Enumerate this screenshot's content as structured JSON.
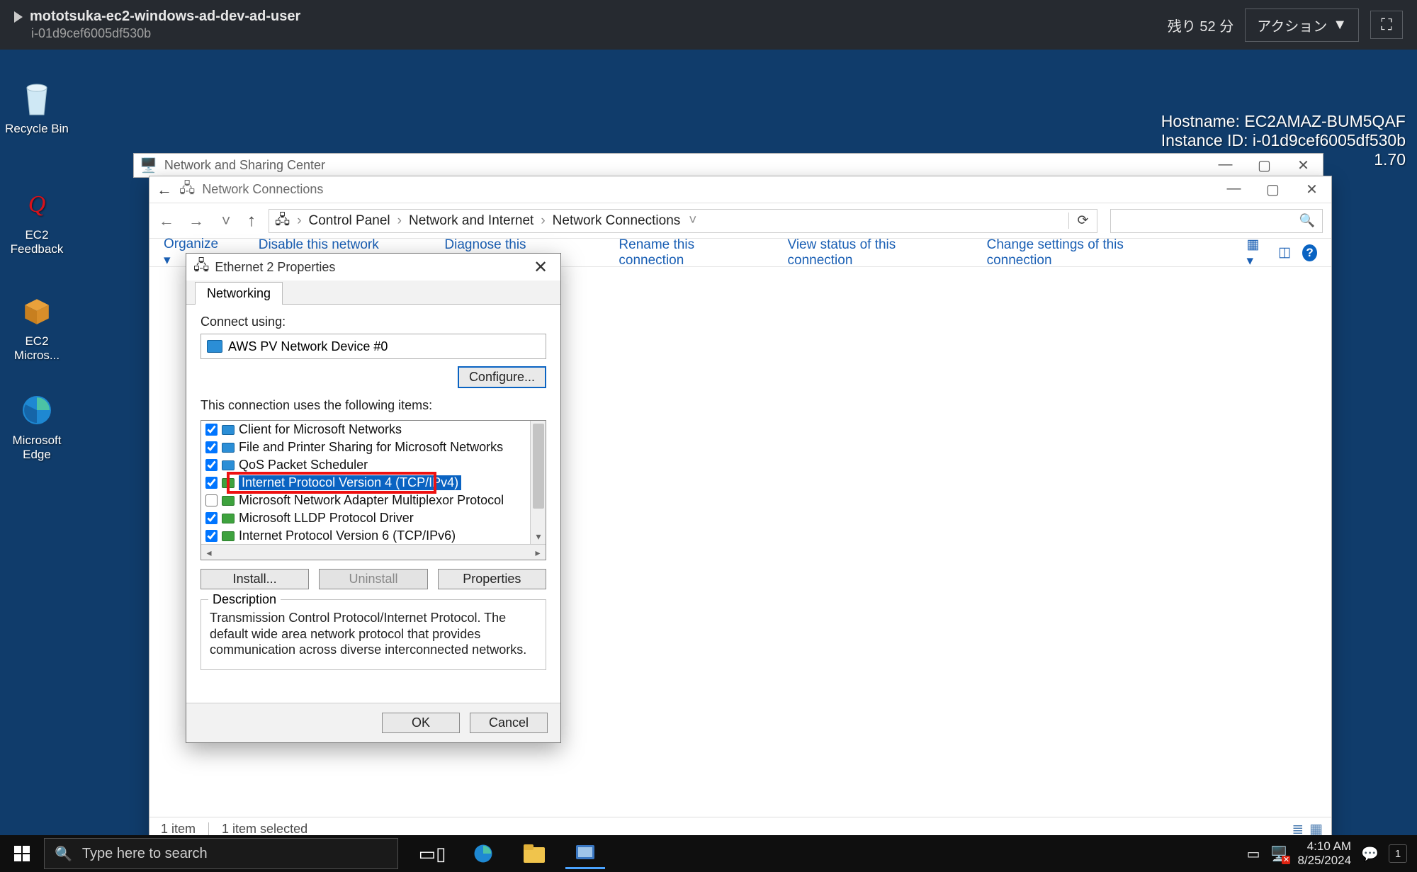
{
  "session": {
    "title": "mototsuka-ec2-windows-ad-dev-ad-user",
    "instance_id": "i-01d9cef6005df530b",
    "time_remaining": "残り 52 分",
    "action_label": "アクション",
    "fullscreen_icon": "⛶"
  },
  "overlay": {
    "hostname_line": "Hostname: EC2AMAZ-BUM5QAF",
    "instance_line": "Instance ID: i-01d9cef6005df530b",
    "version": "1.70"
  },
  "desktop_icons": {
    "recycle": "Recycle Bin",
    "ec2_feedback": "EC2 Feedback",
    "ec2_micros": "EC2 Micros...",
    "edge": "Microsoft Edge"
  },
  "window_nsc": {
    "title": "Network and Sharing Center"
  },
  "window_nc": {
    "title": "Network Connections",
    "breadcrumbs": [
      "Control Panel",
      "Network and Internet",
      "Network Connections"
    ],
    "search_placeholder": "",
    "toolbar": {
      "organize": "Organize",
      "disable": "Disable this network device",
      "diagnose": "Diagnose this connection",
      "rename": "Rename this connection",
      "view_status": "View status of this connection",
      "change_settings": "Change settings of this connection"
    },
    "status_items": "1 item",
    "status_selected": "1 item selected"
  },
  "props": {
    "title": "Ethernet 2 Properties",
    "tab": "Networking",
    "connect_using_label": "Connect using:",
    "adapter_name": "AWS PV Network Device #0",
    "configure_label": "Configure...",
    "items_label": "This connection uses the following items:",
    "items": [
      {
        "checked": true,
        "icon": "blue",
        "label": "Client for Microsoft Networks",
        "selected": false
      },
      {
        "checked": true,
        "icon": "blue",
        "label": "File and Printer Sharing for Microsoft Networks",
        "selected": false
      },
      {
        "checked": true,
        "icon": "blue",
        "label": "QoS Packet Scheduler",
        "selected": false
      },
      {
        "checked": true,
        "icon": "green",
        "label": "Internet Protocol Version 4 (TCP/IPv4)",
        "selected": true,
        "highlighted": true
      },
      {
        "checked": false,
        "icon": "green",
        "label": "Microsoft Network Adapter Multiplexor Protocol",
        "selected": false
      },
      {
        "checked": true,
        "icon": "green",
        "label": "Microsoft LLDP Protocol Driver",
        "selected": false
      },
      {
        "checked": true,
        "icon": "green",
        "label": "Internet Protocol Version 6 (TCP/IPv6)",
        "selected": false
      }
    ],
    "install_label": "Install...",
    "uninstall_label": "Uninstall",
    "properties_label": "Properties",
    "description_legend": "Description",
    "description_text": "Transmission Control Protocol/Internet Protocol. The default wide area network protocol that provides communication across diverse interconnected networks.",
    "ok_label": "OK",
    "cancel_label": "Cancel"
  },
  "taskbar": {
    "search_placeholder": "Type here to search",
    "time": "4:10 AM",
    "date": "8/25/2024",
    "notif_count": "1"
  }
}
